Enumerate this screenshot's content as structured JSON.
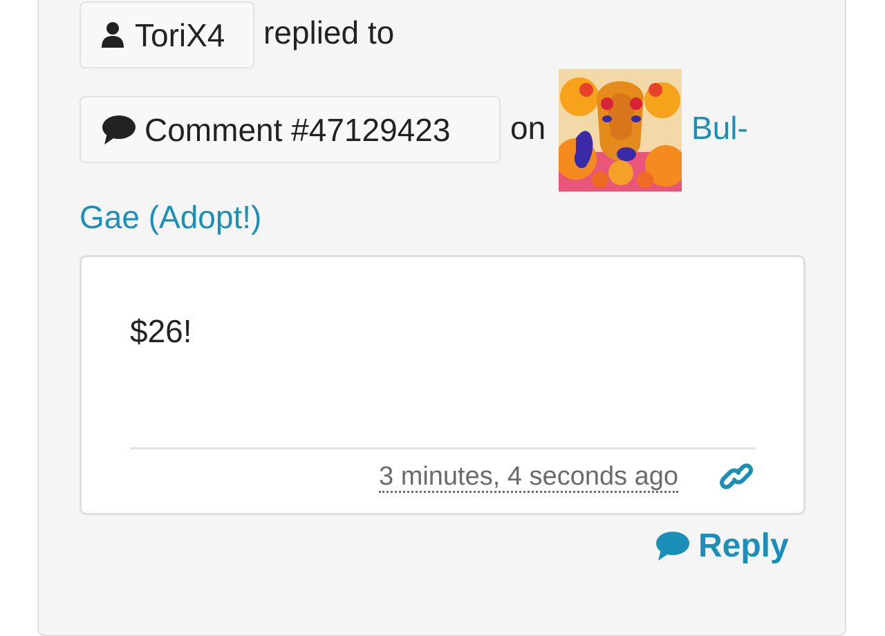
{
  "notification": {
    "user": {
      "name": "ToriX4",
      "icon": "user-icon"
    },
    "replied_to_text": "replied to",
    "comment": {
      "label": "Comment #47129423",
      "icon": "comment-icon"
    },
    "on_text": "on",
    "submission": {
      "title_part1": "Bul-",
      "title_part2": "Gae (Adopt!)",
      "thumbnail_alt": "Bul-Gae (Adopt!)"
    }
  },
  "comment_body": {
    "text": "$26!",
    "timestamp": "3 minutes, 4 seconds ago",
    "permalink_icon": "link-icon"
  },
  "actions": {
    "reply_label": "Reply",
    "reply_icon": "comment-icon"
  },
  "colors": {
    "accent": "#1a8fb7",
    "card_bg": "#f5f5f5",
    "text": "#222222",
    "muted": "#6b6b6b"
  }
}
